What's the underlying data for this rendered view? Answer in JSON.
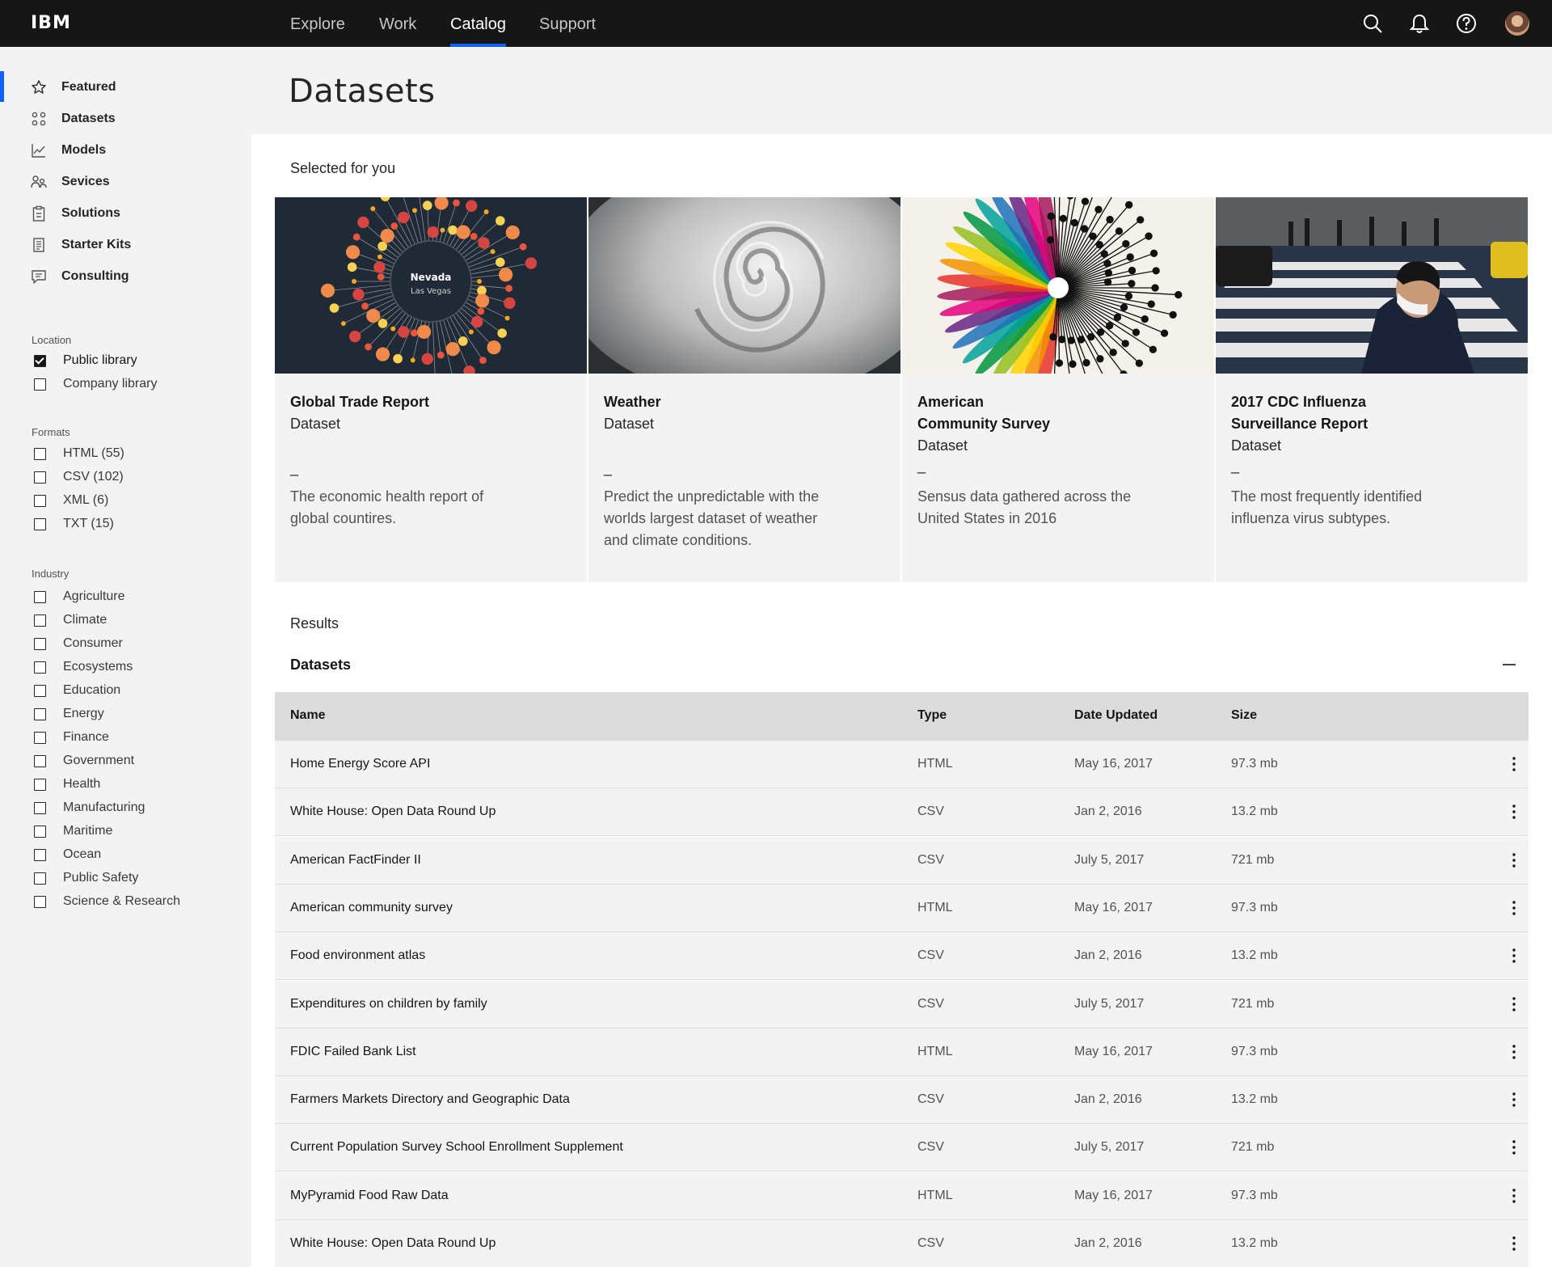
{
  "header": {
    "logo": "IBM",
    "nav": [
      "Explore",
      "Work",
      "Catalog",
      "Support"
    ],
    "active_nav": "Catalog"
  },
  "sidebar": {
    "items": [
      {
        "label": "Featured",
        "icon": "star-icon"
      },
      {
        "label": "Datasets",
        "icon": "datasets-icon"
      },
      {
        "label": "Models",
        "icon": "chart-line-icon"
      },
      {
        "label": "Sevices",
        "icon": "users-icon"
      },
      {
        "label": "Solutions",
        "icon": "clipboard-icon"
      },
      {
        "label": "Starter Kits",
        "icon": "document-icon"
      },
      {
        "label": "Consulting",
        "icon": "chat-icon"
      }
    ],
    "location": {
      "title": "Location",
      "options": [
        {
          "label": "Public library",
          "checked": true
        },
        {
          "label": "Company library",
          "checked": false
        }
      ]
    },
    "formats": {
      "title": "Formats",
      "options": [
        "HTML (55)",
        "CSV (102)",
        "XML (6)",
        "TXT (15)"
      ]
    },
    "industry": {
      "title": "Industry",
      "options": [
        "Agriculture",
        "Climate",
        "Consumer",
        "Ecosystems",
        "Education",
        "Energy",
        "Finance",
        "Government",
        "Health",
        "Manufacturing",
        "Maritime",
        "Ocean",
        "Public Safety",
        "Science & Research"
      ]
    }
  },
  "main": {
    "title": "Datasets",
    "selected_label": "Selected for you",
    "cards": [
      {
        "title_lines": [
          "Global Trade Report"
        ],
        "type": "Dataset",
        "dash": "_",
        "desc_lines": [
          "The economic health report of",
          "global countires."
        ],
        "image_text": [
          "Nevada",
          "Las Vegas"
        ]
      },
      {
        "title_lines": [
          "Weather"
        ],
        "type": "Dataset",
        "dash": "_",
        "desc_lines": [
          "Predict the unpredictable with the",
          "worlds largest dataset of weather",
          "and climate conditions."
        ]
      },
      {
        "title_lines": [
          "American",
          "Community Survey"
        ],
        "type": "Dataset",
        "dash": "_",
        "desc_lines": [
          "Sensus data gathered across the",
          "United States in 2016"
        ]
      },
      {
        "title_lines": [
          "2017 CDC Influenza",
          "Surveillance Report"
        ],
        "type": "Dataset",
        "dash": "_",
        "desc_lines": [
          "The most frequently identified",
          "influenza virus subtypes."
        ]
      }
    ],
    "results_label": "Results",
    "table": {
      "heading": "Datasets",
      "columns": [
        "Name",
        "Type",
        "Date Updated",
        "Size"
      ],
      "rows": [
        [
          "Home Energy Score API",
          "HTML",
          "May 16, 2017",
          "97.3 mb"
        ],
        [
          "White House: Open Data Round Up",
          "CSV",
          "Jan 2, 2016",
          "13.2 mb"
        ],
        [
          "American FactFinder II",
          "CSV",
          "July 5, 2017",
          "721 mb"
        ],
        [
          "American community survey",
          "HTML",
          "May 16, 2017",
          "97.3 mb"
        ],
        [
          "Food environment atlas",
          "CSV",
          "Jan 2, 2016",
          "13.2 mb"
        ],
        [
          "Expenditures on children by family",
          "CSV",
          "July 5, 2017",
          "721 mb"
        ],
        [
          "FDIC Failed Bank List",
          "HTML",
          "May 16, 2017",
          "97.3 mb"
        ],
        [
          "Farmers Markets Directory and Geographic Data",
          "CSV",
          "Jan 2, 2016",
          "13.2 mb"
        ],
        [
          "Current Population Survey School Enrollment Supplement",
          "CSV",
          "July 5, 2017",
          "721 mb"
        ],
        [
          "MyPyramid Food Raw Data",
          "HTML",
          "May 16, 2017",
          "97.3 mb"
        ],
        [
          "White House: Open Data Round Up",
          "CSV",
          "Jan 2, 2016",
          "13.2 mb"
        ]
      ]
    }
  },
  "colors": {
    "accent": "#0f62fe",
    "topbar": "#161616",
    "background": "#f3f3f3"
  }
}
